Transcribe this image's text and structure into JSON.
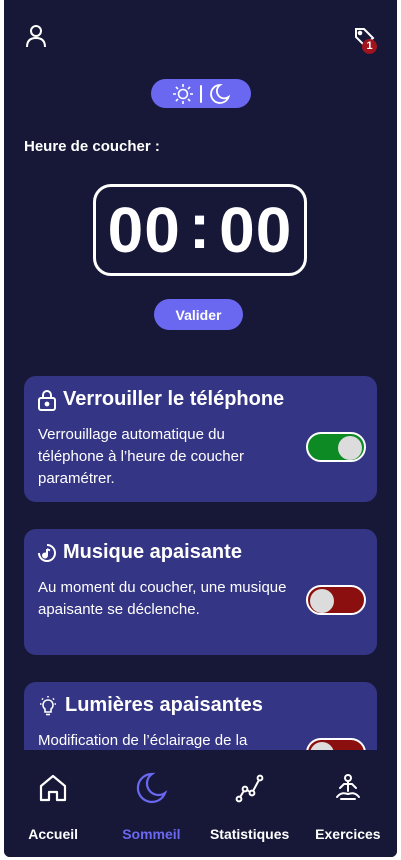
{
  "header": {
    "profile_icon": "user-icon",
    "tag_icon": "tag-icon",
    "notification_count": "1"
  },
  "mode_toggle": {
    "day_icon": "sun-icon",
    "night_icon": "moon-icon"
  },
  "bedtime": {
    "label": "Heure de coucher :",
    "hours": "00",
    "separator": ":",
    "minutes": "00",
    "validate_label": "Valider"
  },
  "cards": [
    {
      "icon": "lock-icon",
      "title": "Verrouiller le téléphone",
      "description": "Verrouillage automatique du téléphone à l’heure de coucher paramétrer.",
      "enabled": true
    },
    {
      "icon": "music-icon",
      "title": "Musique apaisante",
      "description": "Au moment du coucher, une musique apaisante se déclenche.",
      "enabled": false
    },
    {
      "icon": "lightbulb-icon",
      "title": "Lumières apaisantes",
      "description": "Modification de l’éclairage de la",
      "enabled": false
    }
  ],
  "nav": {
    "items": [
      {
        "label": "Accueil",
        "icon": "home-icon",
        "active": false
      },
      {
        "label": "Sommeil",
        "icon": "moon-icon",
        "active": true
      },
      {
        "label": "Statistiques",
        "icon": "chart-icon",
        "active": false
      },
      {
        "label": "Exercices",
        "icon": "meditation-icon",
        "active": false
      }
    ]
  },
  "colors": {
    "background": "#171838",
    "card": "#353585",
    "accent": "#6a68f0",
    "toggle_on": "#0e8a25",
    "toggle_off": "#8c0f0f",
    "badge": "#a0141e"
  }
}
